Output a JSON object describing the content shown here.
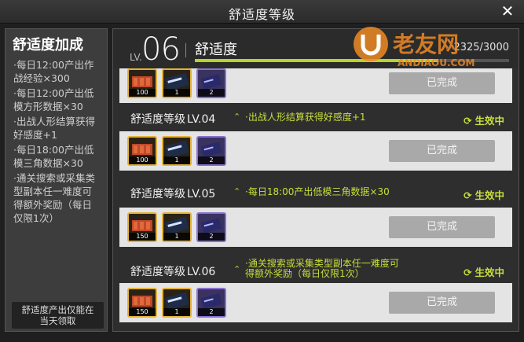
{
  "window": {
    "title": "舒适度等级"
  },
  "sidebar": {
    "title": "舒适度加成",
    "lines": [
      "·每日12:00产出作",
      "战经验×300",
      "·每日12:00产出低",
      "模方形数据×30",
      "·出战人形结算获得",
      "好感度+1",
      "·每日18:00产出低",
      "模三角数据×30",
      "·通关搜索或采集类",
      "型副本任一难度可",
      "得额外奖励（每日",
      "仅限1次）"
    ],
    "note_line1": "舒适度产出仅能在",
    "note_line2": "当天领取"
  },
  "header": {
    "lv_prefix": "LV.",
    "lv_number": "06",
    "label": "舒适度",
    "progress_text": "2325/3000",
    "progress_fraction": 0.775
  },
  "levels": [
    {
      "name": "",
      "lv": "",
      "desc1": "",
      "desc2": "",
      "status": "",
      "rewards": [
        {
          "icon": "ammo-box-icon",
          "qty": "100"
        },
        {
          "icon": "combat-report-icon",
          "qty": "1"
        },
        {
          "icon": "data-chip-icon",
          "qty": "2"
        }
      ],
      "button": "已完成"
    },
    {
      "name": "舒适度等级",
      "lv": "LV.04",
      "desc1": "·出战人形结算获得好感度+1",
      "desc2": "",
      "status": "生效中",
      "rewards": [
        {
          "icon": "ammo-box-icon",
          "qty": "100"
        },
        {
          "icon": "combat-report-icon",
          "qty": "1"
        },
        {
          "icon": "data-chip-icon",
          "qty": "2"
        }
      ],
      "button": "已完成"
    },
    {
      "name": "舒适度等级",
      "lv": "LV.05",
      "desc1": "·每日18:00产出低模三角数据×30",
      "desc2": "",
      "status": "生效中",
      "rewards": [
        {
          "icon": "ammo-box-icon",
          "qty": "150"
        },
        {
          "icon": "combat-report-icon",
          "qty": "1"
        },
        {
          "icon": "data-chip-icon",
          "qty": "2"
        }
      ],
      "button": "已完成"
    },
    {
      "name": "舒适度等级",
      "lv": "LV.06",
      "desc1": "·通关搜索或采集类型副本任一难度可",
      "desc2": "得额外奖励（每日仅限1次）",
      "status": "生效中",
      "rewards": [
        {
          "icon": "ammo-box-icon",
          "qty": "150"
        },
        {
          "icon": "combat-report-icon",
          "qty": "1"
        },
        {
          "icon": "data-chip-icon",
          "qty": "2"
        }
      ],
      "button": "已完成"
    }
  ],
  "watermark": {
    "text": "老友网",
    "url_text": "ANDIAOU.COM"
  },
  "colors": {
    "accent": "#c8df3a",
    "gold_frame": "#e3b23a",
    "purple_frame": "#8a6fd0"
  }
}
